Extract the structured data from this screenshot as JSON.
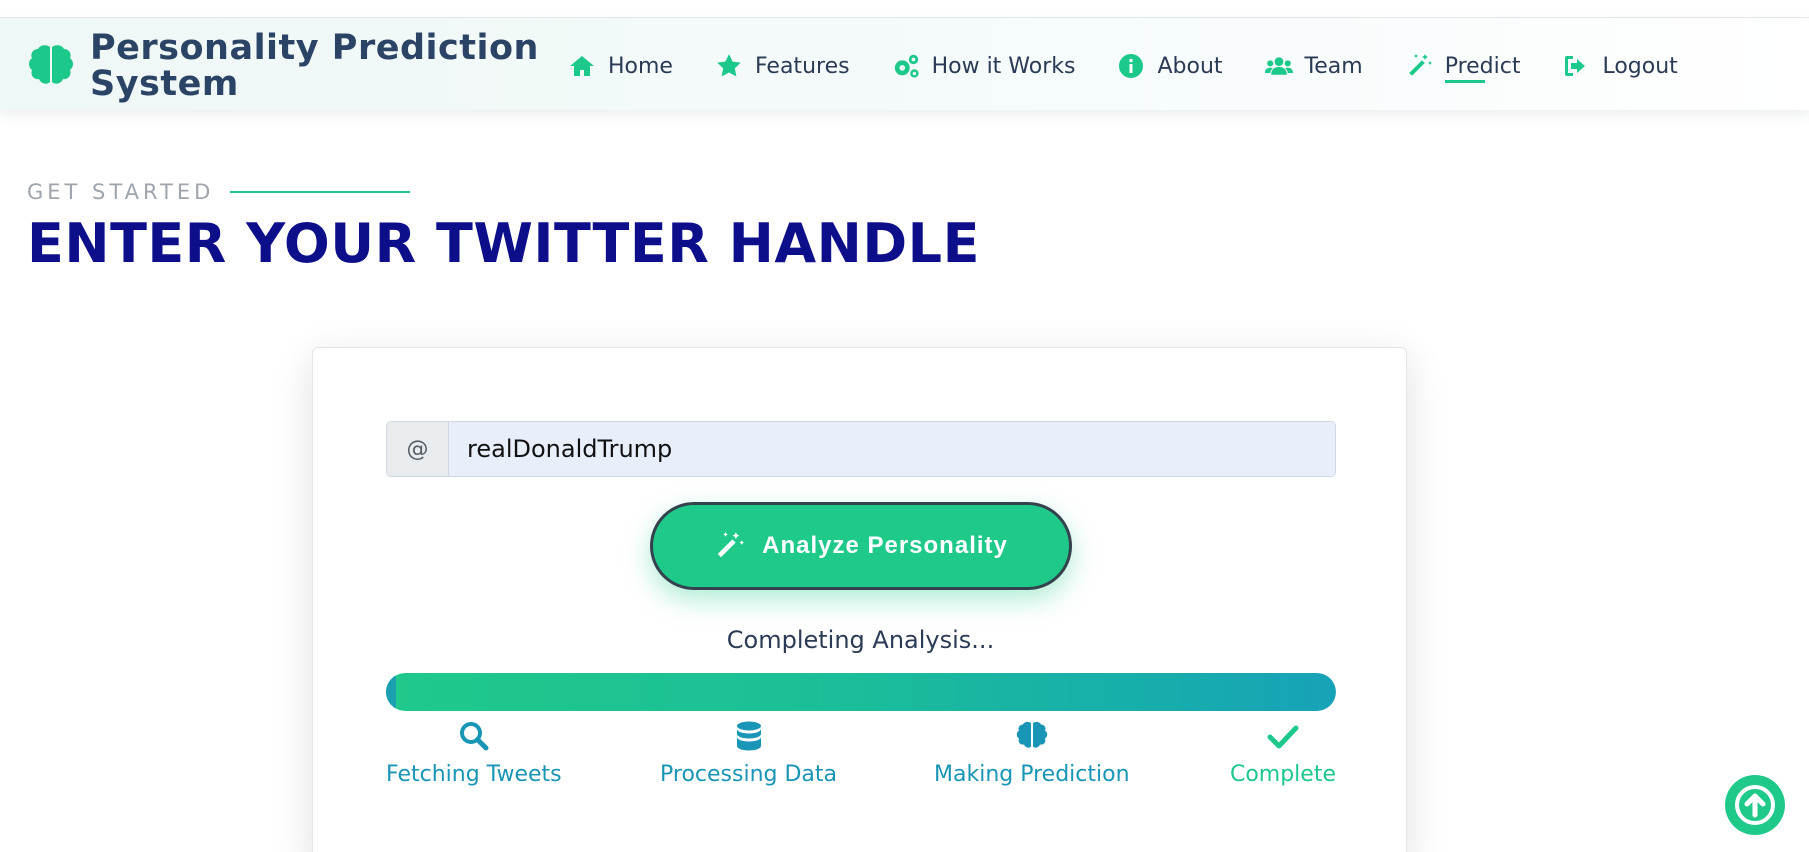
{
  "brand": {
    "title_line1": "Personality Prediction",
    "title_line2": "System",
    "icon": "brain-icon"
  },
  "nav": {
    "items": [
      {
        "label": "Home",
        "icon": "home-icon"
      },
      {
        "label": "Features",
        "icon": "star-icon"
      },
      {
        "label": "How it Works",
        "icon": "cogs-icon"
      },
      {
        "label": "About",
        "icon": "info-icon"
      },
      {
        "label": "Team",
        "icon": "users-icon"
      },
      {
        "label": "Predict",
        "icon": "magic-wand-icon",
        "active": true
      },
      {
        "label": "Logout",
        "icon": "logout-icon"
      }
    ]
  },
  "section": {
    "eyebrow": "GET STARTED",
    "headline": "ENTER YOUR TWITTER HANDLE"
  },
  "form": {
    "prefix": "@",
    "handle_value": "realDonaldTrump",
    "button_label": "Analyze Personality",
    "button_icon": "magic-wand-icon"
  },
  "progress": {
    "status": "Completing Analysis...",
    "percent": 100,
    "steps": [
      {
        "label": "Fetching Tweets",
        "icon": "search-icon"
      },
      {
        "label": "Processing Data",
        "icon": "database-icon"
      },
      {
        "label": "Making Prediction",
        "icon": "brain-icon"
      },
      {
        "label": "Complete",
        "icon": "check-icon"
      }
    ]
  },
  "colors": {
    "accent": "#1dc88b",
    "headline": "#0d0f8a",
    "step_blue": "#1995b6",
    "text": "#2b3b55"
  },
  "scroll_top_icon": "arrow-up-icon"
}
